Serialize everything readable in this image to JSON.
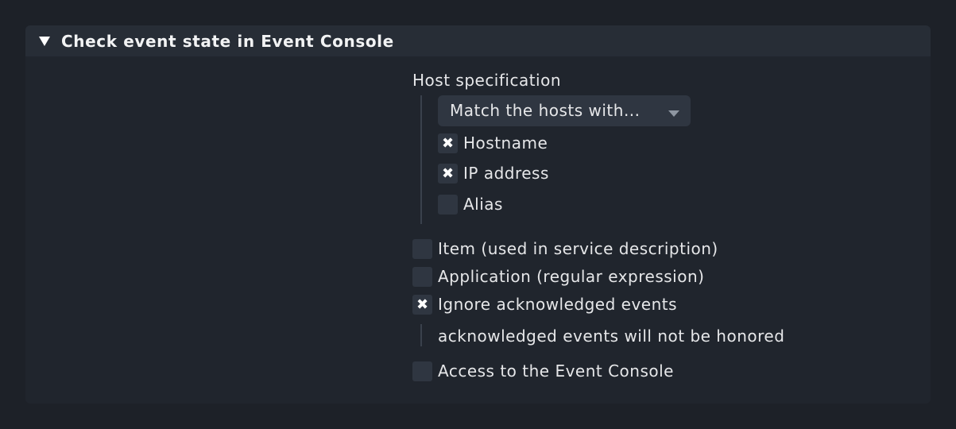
{
  "section": {
    "title": "Check event state in Event Console",
    "expanded": true
  },
  "host_spec": {
    "label": "Host specification",
    "select_value": "Match the hosts with...",
    "options": [
      {
        "label": "Hostname",
        "checked": true
      },
      {
        "label": "IP address",
        "checked": true
      },
      {
        "label": "Alias",
        "checked": false
      }
    ]
  },
  "options": {
    "item": {
      "label": "Item (used in service description)",
      "checked": false
    },
    "application": {
      "label": "Application (regular expression)",
      "checked": false
    },
    "ignore_ack": {
      "label": "Ignore acknowledged events",
      "checked": true,
      "note": "acknowledged events will not be honored"
    },
    "access": {
      "label": "Access to the Event Console",
      "checked": false
    }
  },
  "icons": {
    "collapse": "triangle-down-icon",
    "check_mark": "✖",
    "dropdown": "dropdown-arrow-icon"
  },
  "colors": {
    "background": "#1d2128",
    "panel": "#20252d",
    "header": "#272d36",
    "control": "#2f3641",
    "text": "#e6e7e9"
  }
}
